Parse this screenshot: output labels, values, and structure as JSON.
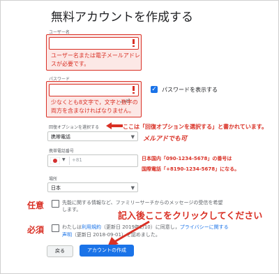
{
  "title": "無料アカウントを作成する",
  "username": {
    "label": "ユーザー名",
    "error_line1": "ユーザー名または電子メールアドレ",
    "error_line2": "スが必要です。"
  },
  "password": {
    "label": "パスワード",
    "error_line1": "少なくとも8文字で，文字と数字の",
    "error_line2": "両方を含まなければなりません。",
    "show_password_label": "パスワードを表示する"
  },
  "recovery": {
    "label": "回復オプションを選択する",
    "selected": "携帯電話",
    "annotation_main": "ここは「回復オプションを選択する」と書かれています。",
    "annotation_sub": "メルアドでも可"
  },
  "phone": {
    "label": "携帯電話番号",
    "country_code": "+81",
    "annotation_line1": "日本国内「090-1234-5678」の番号は",
    "annotation_line2": "国際電話「+8190-1234-5678」になる。"
  },
  "location": {
    "label": "場所",
    "selected": "日本"
  },
  "optional": {
    "tag": "任意",
    "text_line1": "先能に関する情報など、ファミリーサーチからのメッセージの受信を希望",
    "text_line2": "します。"
  },
  "required": {
    "tag": "必須",
    "text_prefix": "わたしは",
    "terms_link": "利用規約",
    "text_mid": "（更新日 2019年2/10）に同意し，",
    "privacy_link": "プライバシーに関する",
    "privacy_link2": "声明",
    "text_suffix": "（更新日 2018-09-01）を認めました。"
  },
  "click_annotation": "記入後ここをクリックしてください",
  "buttons": {
    "back": "戻る",
    "create": "アカウントの作成"
  },
  "colors": {
    "error": "#d93025",
    "primary": "#1a73e8"
  }
}
